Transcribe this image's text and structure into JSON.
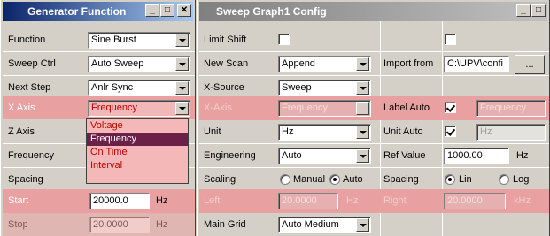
{
  "left_window": {
    "title": "Generator Function",
    "buttons": [
      "_",
      "□",
      "✕"
    ],
    "rows": {
      "function": {
        "label": "Function",
        "value": "Sine Burst"
      },
      "sweep_ctrl": {
        "label": "Sweep Ctrl",
        "value": "Auto Sweep"
      },
      "next_step": {
        "label": "Next Step",
        "value": "Anlr Sync"
      },
      "x_axis": {
        "label": "X Axis",
        "value": "Frequency"
      },
      "z_axis": {
        "label": "Z Axis"
      },
      "frequency": {
        "label": "Frequency"
      },
      "spacing": {
        "label": "Spacing"
      },
      "start": {
        "label": "Start",
        "value": "20000.0",
        "unit": "Hz"
      },
      "stop": {
        "label": "Stop",
        "value": "20.0000",
        "unit": "Hz"
      }
    },
    "xaxis_dropdown": {
      "options": [
        "Voltage",
        "Frequency",
        "On Time",
        "Interval"
      ],
      "selected": "Frequency"
    }
  },
  "right_window": {
    "title": "Sweep Graph1 Config",
    "buttons": [
      "_",
      "□"
    ],
    "rows": {
      "limit_shift": {
        "label": "Limit Shift",
        "checked": false,
        "col3_checked": false
      },
      "new_scan": {
        "label": "New Scan",
        "value": "Append",
        "col3_label": "Import from",
        "col3_value": "C:\\UPV\\confi",
        "browse_label": "..."
      },
      "x_source": {
        "label": "X-Source",
        "value": "Sweep"
      },
      "x_axis": {
        "label": "X-Axis",
        "value": "Frequency",
        "col3_label": "Label Auto",
        "col3_checked": true,
        "col3_value": "Frequency"
      },
      "unit": {
        "label": "Unit",
        "value": "Hz",
        "col3_label": "Unit Auto",
        "col3_checked": true,
        "col3_value": "Hz"
      },
      "engineering": {
        "label": "Engineering",
        "value": "Auto",
        "col3_label": "Ref Value",
        "col3_value": "1000.00",
        "col3_unit": "Hz"
      },
      "scaling": {
        "label": "Scaling",
        "opt1": "Manual",
        "opt2": "Auto",
        "selected": "Auto",
        "col3_label": "Spacing",
        "col3_opt1": "Lin",
        "col3_opt2": "Log",
        "col3_selected": "Lin"
      },
      "left": {
        "label": "Left",
        "value": "20.0000",
        "unit": "Hz",
        "col3_label": "Right",
        "col3_value": "20.0000",
        "col3_unit": "kHz"
      },
      "main_grid": {
        "label": "Main Grid",
        "value": "Auto Medium"
      }
    }
  },
  "colors": {
    "highlight_row": "#e8a0a0",
    "active_title": "#0a246a",
    "inactive_title": "#808080",
    "dropdown_selected": "#6b2147"
  }
}
